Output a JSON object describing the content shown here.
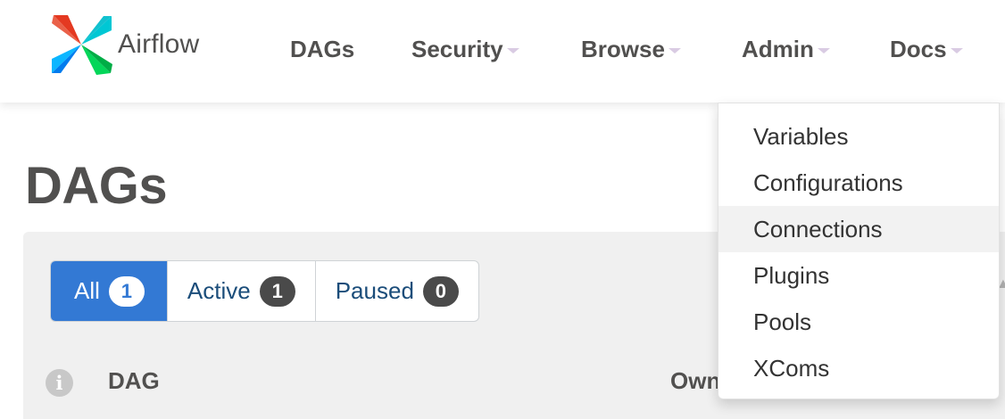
{
  "brand": {
    "name": "Airflow"
  },
  "nav": {
    "dags": "DAGs",
    "security": "Security",
    "browse": "Browse",
    "admin": "Admin",
    "docs": "Docs"
  },
  "admin_menu": {
    "items": [
      "Variables",
      "Configurations",
      "Connections",
      "Plugins",
      "Pools",
      "XComs"
    ],
    "hovered": "Connections"
  },
  "page": {
    "title": "DAGs"
  },
  "filters": {
    "all": {
      "label": "All",
      "count": "1"
    },
    "active": {
      "label": "Active",
      "count": "1"
    },
    "paused": {
      "label": "Paused",
      "count": "0"
    }
  },
  "table": {
    "info_icon_glyph": "i",
    "headers": {
      "dag": "DAG",
      "owner": "Owner"
    }
  },
  "colors": {
    "accent": "#3379d4",
    "text": "#51504f",
    "link": "#1b4d7a",
    "caret": "#d9cbe3",
    "hover": "#f2f2f2"
  }
}
